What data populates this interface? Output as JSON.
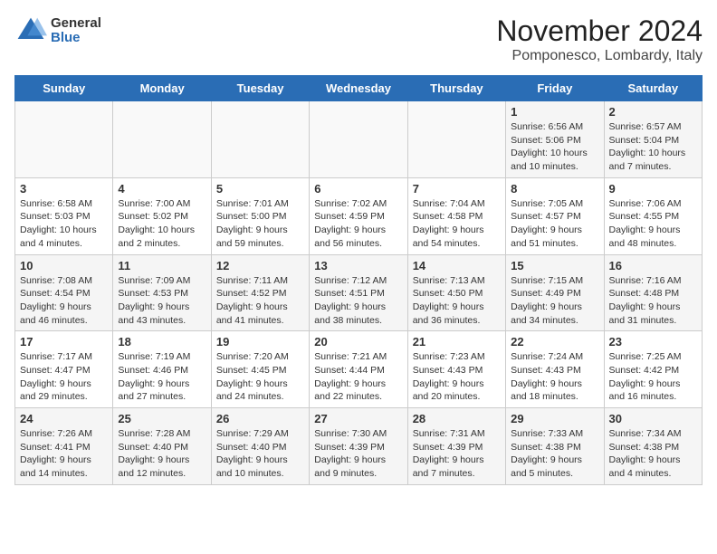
{
  "header": {
    "logo_general": "General",
    "logo_blue": "Blue",
    "month_title": "November 2024",
    "location": "Pomponesco, Lombardy, Italy"
  },
  "weekdays": [
    "Sunday",
    "Monday",
    "Tuesday",
    "Wednesday",
    "Thursday",
    "Friday",
    "Saturday"
  ],
  "weeks": [
    [
      {
        "day": "",
        "info": ""
      },
      {
        "day": "",
        "info": ""
      },
      {
        "day": "",
        "info": ""
      },
      {
        "day": "",
        "info": ""
      },
      {
        "day": "",
        "info": ""
      },
      {
        "day": "1",
        "info": "Sunrise: 6:56 AM\nSunset: 5:06 PM\nDaylight: 10 hours and 10 minutes."
      },
      {
        "day": "2",
        "info": "Sunrise: 6:57 AM\nSunset: 5:04 PM\nDaylight: 10 hours and 7 minutes."
      }
    ],
    [
      {
        "day": "3",
        "info": "Sunrise: 6:58 AM\nSunset: 5:03 PM\nDaylight: 10 hours and 4 minutes."
      },
      {
        "day": "4",
        "info": "Sunrise: 7:00 AM\nSunset: 5:02 PM\nDaylight: 10 hours and 2 minutes."
      },
      {
        "day": "5",
        "info": "Sunrise: 7:01 AM\nSunset: 5:00 PM\nDaylight: 9 hours and 59 minutes."
      },
      {
        "day": "6",
        "info": "Sunrise: 7:02 AM\nSunset: 4:59 PM\nDaylight: 9 hours and 56 minutes."
      },
      {
        "day": "7",
        "info": "Sunrise: 7:04 AM\nSunset: 4:58 PM\nDaylight: 9 hours and 54 minutes."
      },
      {
        "day": "8",
        "info": "Sunrise: 7:05 AM\nSunset: 4:57 PM\nDaylight: 9 hours and 51 minutes."
      },
      {
        "day": "9",
        "info": "Sunrise: 7:06 AM\nSunset: 4:55 PM\nDaylight: 9 hours and 48 minutes."
      }
    ],
    [
      {
        "day": "10",
        "info": "Sunrise: 7:08 AM\nSunset: 4:54 PM\nDaylight: 9 hours and 46 minutes."
      },
      {
        "day": "11",
        "info": "Sunrise: 7:09 AM\nSunset: 4:53 PM\nDaylight: 9 hours and 43 minutes."
      },
      {
        "day": "12",
        "info": "Sunrise: 7:11 AM\nSunset: 4:52 PM\nDaylight: 9 hours and 41 minutes."
      },
      {
        "day": "13",
        "info": "Sunrise: 7:12 AM\nSunset: 4:51 PM\nDaylight: 9 hours and 38 minutes."
      },
      {
        "day": "14",
        "info": "Sunrise: 7:13 AM\nSunset: 4:50 PM\nDaylight: 9 hours and 36 minutes."
      },
      {
        "day": "15",
        "info": "Sunrise: 7:15 AM\nSunset: 4:49 PM\nDaylight: 9 hours and 34 minutes."
      },
      {
        "day": "16",
        "info": "Sunrise: 7:16 AM\nSunset: 4:48 PM\nDaylight: 9 hours and 31 minutes."
      }
    ],
    [
      {
        "day": "17",
        "info": "Sunrise: 7:17 AM\nSunset: 4:47 PM\nDaylight: 9 hours and 29 minutes."
      },
      {
        "day": "18",
        "info": "Sunrise: 7:19 AM\nSunset: 4:46 PM\nDaylight: 9 hours and 27 minutes."
      },
      {
        "day": "19",
        "info": "Sunrise: 7:20 AM\nSunset: 4:45 PM\nDaylight: 9 hours and 24 minutes."
      },
      {
        "day": "20",
        "info": "Sunrise: 7:21 AM\nSunset: 4:44 PM\nDaylight: 9 hours and 22 minutes."
      },
      {
        "day": "21",
        "info": "Sunrise: 7:23 AM\nSunset: 4:43 PM\nDaylight: 9 hours and 20 minutes."
      },
      {
        "day": "22",
        "info": "Sunrise: 7:24 AM\nSunset: 4:43 PM\nDaylight: 9 hours and 18 minutes."
      },
      {
        "day": "23",
        "info": "Sunrise: 7:25 AM\nSunset: 4:42 PM\nDaylight: 9 hours and 16 minutes."
      }
    ],
    [
      {
        "day": "24",
        "info": "Sunrise: 7:26 AM\nSunset: 4:41 PM\nDaylight: 9 hours and 14 minutes."
      },
      {
        "day": "25",
        "info": "Sunrise: 7:28 AM\nSunset: 4:40 PM\nDaylight: 9 hours and 12 minutes."
      },
      {
        "day": "26",
        "info": "Sunrise: 7:29 AM\nSunset: 4:40 PM\nDaylight: 9 hours and 10 minutes."
      },
      {
        "day": "27",
        "info": "Sunrise: 7:30 AM\nSunset: 4:39 PM\nDaylight: 9 hours and 9 minutes."
      },
      {
        "day": "28",
        "info": "Sunrise: 7:31 AM\nSunset: 4:39 PM\nDaylight: 9 hours and 7 minutes."
      },
      {
        "day": "29",
        "info": "Sunrise: 7:33 AM\nSunset: 4:38 PM\nDaylight: 9 hours and 5 minutes."
      },
      {
        "day": "30",
        "info": "Sunrise: 7:34 AM\nSunset: 4:38 PM\nDaylight: 9 hours and 4 minutes."
      }
    ]
  ]
}
